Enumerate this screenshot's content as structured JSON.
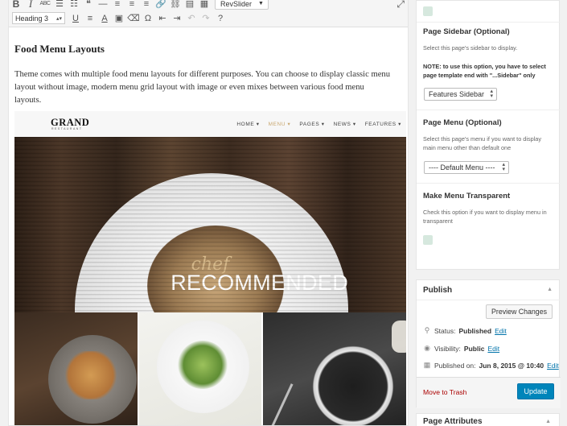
{
  "toolbar": {
    "row1": {
      "bold": "B",
      "italic": "I",
      "strike": "ABC",
      "bullets": "☰",
      "numbers": "☷",
      "quote": "❝",
      "hr": "—",
      "align_left": "≡",
      "align_center": "≡",
      "align_right": "≡",
      "link": "🔗",
      "unlink": "⛓",
      "more": "▤",
      "kitchen_sink": "▦",
      "revslider_label": "RevSlider",
      "fullscreen": "⤢"
    },
    "row2": {
      "format_value": "Heading 3",
      "underline": "U",
      "justify": "≡",
      "text_color": "A",
      "paste_text": "▣",
      "clear": "⌫",
      "omega": "Ω",
      "outdent": "⇤",
      "indent": "⇥",
      "undo": "↶",
      "redo": "↷",
      "help": "?"
    }
  },
  "content": {
    "heading": "Food Menu Layouts",
    "paragraph": "Theme comes with multiple food menu layouts for different purposes. You can choose to display classic menu layout without image, modern menu grid layout with image or even mixes between various food menu layouts."
  },
  "site_preview": {
    "logo": "GRAND",
    "logo_sub": "RESTAURANT",
    "menu": [
      "HOME ▾",
      "MENU ▾",
      "PAGES ▾",
      "NEWS ▾",
      "FEATURES ▾"
    ],
    "hero_script": "chef",
    "hero_title": "RECOMMENDED"
  },
  "sidebar": {
    "page_sidebar": {
      "title": "Page Sidebar (Optional)",
      "desc": "Select this page's sidebar to display.",
      "note_bold": "NOTE: to use this option, you have to select page template end with \"...Sidebar\" only",
      "select_value": "Features Sidebar"
    },
    "page_menu": {
      "title": "Page Menu (Optional)",
      "desc": "Select this page's menu if you want to display main menu other than default one",
      "select_value": "---- Default Menu ----"
    },
    "transparent": {
      "title": "Make Menu Transparent",
      "desc": "Check this option if you want to display menu in transparent"
    },
    "publish": {
      "title": "Publish",
      "toggle": "▲",
      "preview_button": "Preview Changes",
      "status_label": "Status:",
      "status_value": "Published",
      "visibility_label": "Visibility:",
      "visibility_value": "Public",
      "published_label": "Published on:",
      "published_value": "Jun 8, 2015 @ 10:40",
      "edit": "Edit",
      "trash": "Move to Trash",
      "update_button": "Update"
    },
    "attributes": {
      "title": "Page Attributes",
      "toggle": "▲"
    }
  },
  "colors": {
    "accent": "#0085ba",
    "trash": "#aa0000",
    "menu_active": "#c9a870",
    "checkbox": "#d6e8de"
  }
}
